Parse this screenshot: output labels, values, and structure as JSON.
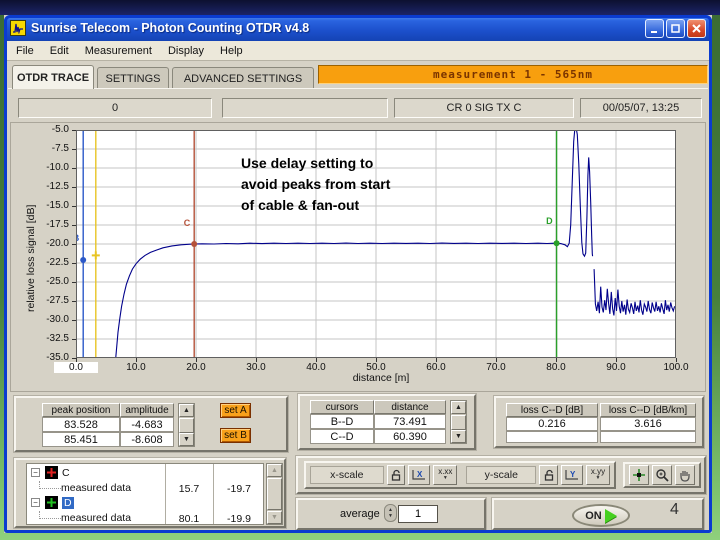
{
  "window": {
    "title": "Sunrise Telecom - Photon Counting OTDR v4.8"
  },
  "menu": {
    "items": [
      "File",
      "Edit",
      "Measurement",
      "Display",
      "Help"
    ]
  },
  "tabs": {
    "items": [
      {
        "label": "OTDR TRACE"
      },
      {
        "label": "SETTINGS"
      },
      {
        "label": "ADVANCED SETTINGS"
      }
    ]
  },
  "measurement_banner": {
    "text": "measurement  1 - 565nm"
  },
  "status_row": {
    "field_left": "0",
    "field_mid": "",
    "signal": "CR 0 SIG TX C",
    "timestamp": "00/05/07, 13:25"
  },
  "chart_annotation": {
    "line1": "Use delay setting to",
    "line2": "avoid peaks from start",
    "line3": "of cable & fan-out"
  },
  "chart_data": {
    "type": "line",
    "title": "OTDR trace",
    "xlabel": "distance [m]",
    "ylabel": "relative loss signal [dB]",
    "xlim": [
      0,
      100
    ],
    "ylim": [
      -35,
      -5
    ],
    "x_ticks": [
      0,
      10,
      20,
      30,
      40,
      50,
      60,
      70,
      80,
      90,
      100
    ],
    "y_ticks": [
      -5,
      -7.5,
      -10,
      -12.5,
      -15,
      -17.5,
      -20,
      -22.5,
      -25,
      -27.5,
      -30,
      -32.5,
      -35
    ],
    "grid": true,
    "trace_color": "#00008b",
    "annotation": "Use delay setting to avoid peaks from start of cable & fan-out",
    "cursors": [
      {
        "name": "A",
        "x": 3.3,
        "color": "#e8c424",
        "marker_y": -21.5,
        "label_y": -21.5,
        "show_label": false,
        "marker": "cross"
      },
      {
        "name": "B",
        "x": 1.2,
        "color": "#2b58c8",
        "marker_y": -22.1,
        "label_y": -19.6,
        "show_label": true,
        "marker": "dot"
      },
      {
        "name": "C",
        "x": 19.7,
        "color": "#b5523a",
        "marker_y": -20.0,
        "label_y": -17.6,
        "show_label": true,
        "marker": "dot"
      },
      {
        "name": "D",
        "x": 80.1,
        "color": "#2aa02a",
        "marker_y": -19.9,
        "label_y": -17.4,
        "show_label": true,
        "marker": "dot"
      }
    ],
    "peaks": [
      {
        "position": 83.528,
        "amplitude": -4.683
      },
      {
        "position": 85.451,
        "amplitude": -8.608
      }
    ],
    "series": [
      {
        "name": "measured data",
        "segments": [
          {
            "points": [
              [
                6.6,
                -35.2
              ],
              [
                6.8,
                -33.4
              ],
              [
                7.0,
                -31.6
              ],
              [
                7.3,
                -29.8
              ],
              [
                7.6,
                -28.2
              ],
              [
                8.0,
                -26.6
              ],
              [
                8.4,
                -25.3
              ],
              [
                8.9,
                -24.2
              ],
              [
                9.4,
                -23.3
              ],
              [
                10.0,
                -22.6
              ],
              [
                10.7,
                -22.0
              ],
              [
                11.5,
                -21.5
              ],
              [
                12.4,
                -21.1
              ],
              [
                13.4,
                -20.8
              ],
              [
                14.5,
                -20.5
              ],
              [
                16,
                -20.25
              ],
              [
                17.5,
                -20.1
              ],
              [
                19,
                -20.03
              ],
              [
                21,
                -19.98
              ],
              [
                23,
                -20.0
              ],
              [
                25,
                -19.93
              ],
              [
                27,
                -19.97
              ],
              [
                29,
                -19.9
              ],
              [
                31,
                -19.95
              ],
              [
                33,
                -19.9
              ],
              [
                35,
                -19.94
              ],
              [
                37,
                -19.89
              ],
              [
                39,
                -19.93
              ],
              [
                41,
                -19.9
              ],
              [
                43,
                -19.94
              ],
              [
                45,
                -19.88
              ],
              [
                47,
                -19.93
              ],
              [
                49,
                -19.9
              ],
              [
                51,
                -19.94
              ],
              [
                53,
                -19.89
              ],
              [
                55,
                -19.92
              ],
              [
                57,
                -19.9
              ],
              [
                59,
                -19.93
              ],
              [
                61,
                -19.88
              ],
              [
                63,
                -19.92
              ],
              [
                65,
                -19.9
              ],
              [
                67,
                -19.94
              ],
              [
                69,
                -19.89
              ],
              [
                71,
                -19.92
              ],
              [
                73,
                -19.9
              ],
              [
                75,
                -19.93
              ],
              [
                77,
                -19.89
              ],
              [
                78.5,
                -19.93
              ],
              [
                79.8,
                -19.9
              ],
              [
                80.8,
                -19.95
              ],
              [
                81.5,
                -20.1
              ],
              [
                81.9,
                -20.35
              ],
              [
                82.2,
                -19.9
              ],
              [
                82.45,
                -17.5
              ],
              [
                82.7,
                -12.0
              ],
              [
                82.95,
                -6.5
              ],
              [
                83.15,
                -4.75
              ],
              [
                83.35,
                -4.7
              ],
              [
                83.55,
                -5.6
              ],
              [
                83.8,
                -9.5
              ],
              [
                84.05,
                -15.0
              ],
              [
                84.3,
                -19.8
              ],
              [
                84.5,
                -21.3
              ],
              [
                84.75,
                -21.6
              ],
              [
                84.95,
                -21.2
              ],
              [
                85.15,
                -16.5
              ],
              [
                85.32,
                -11.0
              ],
              [
                85.45,
                -8.61
              ],
              [
                85.6,
                -10.5
              ],
              [
                85.78,
                -14.5
              ],
              [
                85.95,
                -19.0
              ],
              [
                86.05,
                -21.3
              ],
              [
                86.1,
                -21.6
              ]
            ]
          },
          {
            "x_start": 86.35,
            "dx": 0.22,
            "values": [
              -23.3,
              -27.9,
              -28.8,
              -27.6,
              -29.1,
              -25.6,
              -28.3,
              -29.0,
              -27.4,
              -28.7,
              -25.9,
              -27.8,
              -29.2,
              -26.3,
              -28.5,
              -29.4,
              -27.1,
              -28.8,
              -26.0,
              -28.2,
              -29.1,
              -27.5,
              -28.9,
              -28.0,
              -29.3,
              -27.3,
              -28.6,
              -29.0,
              -27.8,
              -28.4,
              -29.2,
              -27.6,
              -28.8,
              -28.1,
              -29.0,
              -27.4,
              -28.7,
              -29.3,
              -27.9,
              -28.3,
              -28.9,
              -27.5,
              -28.6,
              -29.1,
              -27.7,
              -28.4,
              -28.9,
              -27.6,
              -28.8,
              -28.2,
              -29.0,
              -27.8,
              -28.5,
              -29.2,
              -27.4,
              -28.7,
              -28.0,
              -28.9,
              -27.7,
              -28.4,
              -28.8,
              -28.2
            ]
          }
        ]
      }
    ]
  },
  "peaks_panel": {
    "headers": [
      "peak position",
      "amplitude"
    ],
    "rows": [
      [
        "83.528",
        "-4.683"
      ],
      [
        "85.451",
        "-8.608"
      ]
    ]
  },
  "set_buttons": {
    "set_a": "set A",
    "set_b": "set B"
  },
  "cursors_panel": {
    "headers": [
      "cursors",
      "distance"
    ],
    "rows": [
      [
        "B--D",
        "73.491"
      ],
      [
        "C--D",
        "60.390"
      ]
    ]
  },
  "loss_panel": {
    "headers": [
      "loss C--D [dB]",
      "loss C--D [dB/km]"
    ],
    "values": [
      "0.216",
      "3.616"
    ]
  },
  "legend_panel": {
    "groups": [
      {
        "cursor": "C",
        "row_label": "measured data",
        "x_value": "15.7",
        "y_value": "-19.7"
      },
      {
        "cursor": "D",
        "row_label": "measured data",
        "x_value": "80.1",
        "y_value": "-19.9"
      }
    ]
  },
  "scale_toolbar": {
    "x_label": "x-scale",
    "y_label": "y-scale",
    "x_format": "x.xx",
    "y_format": "x.yy"
  },
  "average_control": {
    "label": "average",
    "value": "1"
  },
  "power_button": {
    "label": "ON"
  },
  "page_number": "4"
}
